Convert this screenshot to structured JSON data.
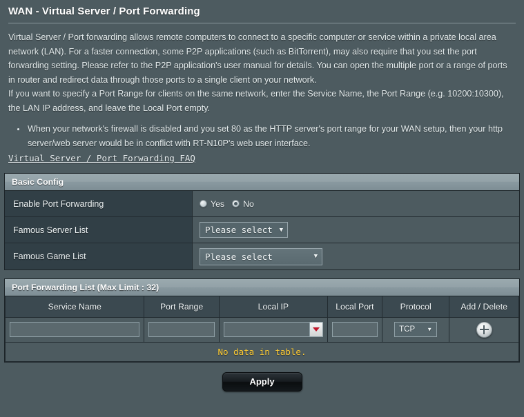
{
  "page": {
    "title": "WAN - Virtual Server / Port Forwarding"
  },
  "description": {
    "paragraph1": "Virtual Server / Port forwarding allows remote computers to connect to a specific computer or service within a private local area network (LAN). For a faster connection, some P2P applications (such as BitTorrent), may also require that you set the port forwarding setting. Please refer to the P2P application's user manual for details. You can open the multiple port or a range of ports in router and redirect data through those ports to a single client on your network.",
    "paragraph2": "If you want to specify a Port Range for clients on the same network, enter the Service Name, the Port Range (e.g. 10200:10300), the LAN IP address, and leave the Local Port empty.",
    "bullets": [
      "When your network's firewall is disabled and you set 80 as the HTTP server's port range for your WAN setup, then your http server/web server would be in conflict with RT-N10P's web user interface."
    ],
    "faq_link": "Virtual Server / Port Forwarding FAQ"
  },
  "basic_config": {
    "section_title": "Basic Config",
    "enable_port_forwarding": {
      "label": "Enable Port Forwarding",
      "options": [
        "Yes",
        "No"
      ],
      "selected": "No"
    },
    "famous_server_list": {
      "label": "Famous Server List",
      "selected": "Please select"
    },
    "famous_game_list": {
      "label": "Famous Game List",
      "selected": "Please select"
    }
  },
  "port_forwarding_list": {
    "section_title": "Port Forwarding List (Max Limit : 32)",
    "columns": [
      "Service Name",
      "Port Range",
      "Local IP",
      "Local Port",
      "Protocol",
      "Add / Delete"
    ],
    "new_row": {
      "service_name": "",
      "port_range": "",
      "local_ip": "",
      "local_port": "",
      "protocol": "TCP"
    },
    "empty_message": "No data in table."
  },
  "footer": {
    "apply_label": "Apply"
  },
  "colors": {
    "background": "#4d5b60",
    "label_column": "#313f46",
    "section_header_top": "#9aa9ae",
    "empty_message": "#ffcc33",
    "ip_arrow_red": "#c0172b"
  }
}
